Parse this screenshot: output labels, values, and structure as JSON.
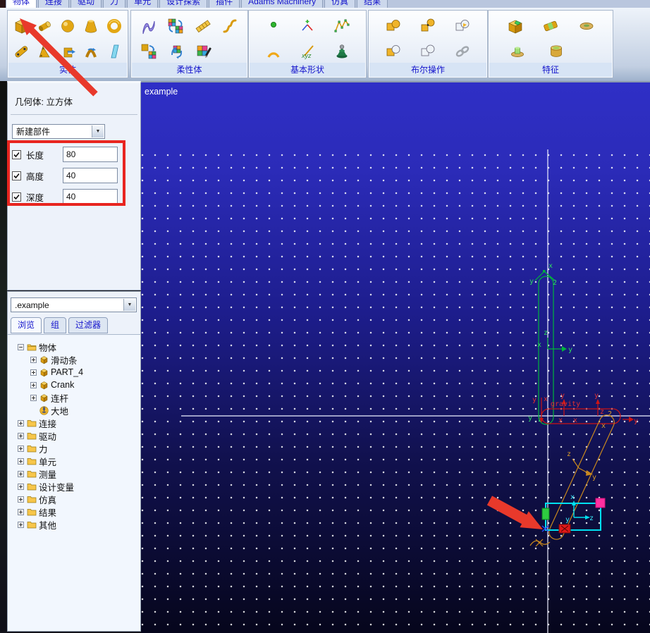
{
  "menu": {
    "tabs": [
      "物体",
      "连接",
      "驱动",
      "力",
      "单元",
      "设计探索",
      "插件",
      "Adams Machinery",
      "仿真",
      "结果"
    ]
  },
  "ribbon": {
    "groups": [
      {
        "label": "实体"
      },
      {
        "label": "柔性体"
      },
      {
        "label": "基本形状"
      },
      {
        "label": "布尔操作"
      },
      {
        "label": "特征"
      }
    ],
    "xyz_icon_text": "xyz"
  },
  "dialog": {
    "title": "几何体: 立方体",
    "part_select": "新建部件",
    "fields": [
      {
        "label": "长度",
        "value": "80",
        "checked": true
      },
      {
        "label": "高度",
        "value": "40",
        "checked": true
      },
      {
        "label": "深度",
        "value": "40",
        "checked": true
      }
    ]
  },
  "browser": {
    "model_select": ".example",
    "tabs": [
      {
        "label": "浏览",
        "active": true
      },
      {
        "label": "组",
        "active": false
      },
      {
        "label": "过滤器",
        "active": false
      }
    ],
    "tree": [
      {
        "label": "物体"
      },
      {
        "label": "滑动条"
      },
      {
        "label": "PART_4"
      },
      {
        "label": "Crank"
      },
      {
        "label": "连杆"
      },
      {
        "label": "大地"
      },
      {
        "label": "连接"
      },
      {
        "label": "驱动"
      },
      {
        "label": "力"
      },
      {
        "label": "单元"
      },
      {
        "label": "测量"
      },
      {
        "label": "设计变量"
      },
      {
        "label": "仿真"
      },
      {
        "label": "结果"
      },
      {
        "label": "其他"
      }
    ]
  },
  "viewport": {
    "title": "example",
    "gravity_label": "gravity",
    "glyphs": {
      "x": "x",
      "y": "y",
      "z": "z",
      "two": "2"
    }
  },
  "colors": {
    "viewport_top": "#2f2fc6",
    "viewport_bottom": "#06061c",
    "highlight_red": "#e8392b",
    "green_part": "#00b43c",
    "red_link": "#cc1515",
    "orange_link": "#c8881e",
    "cyan_part": "#00e0f0",
    "magenta_handle": "#ff2fa0"
  }
}
